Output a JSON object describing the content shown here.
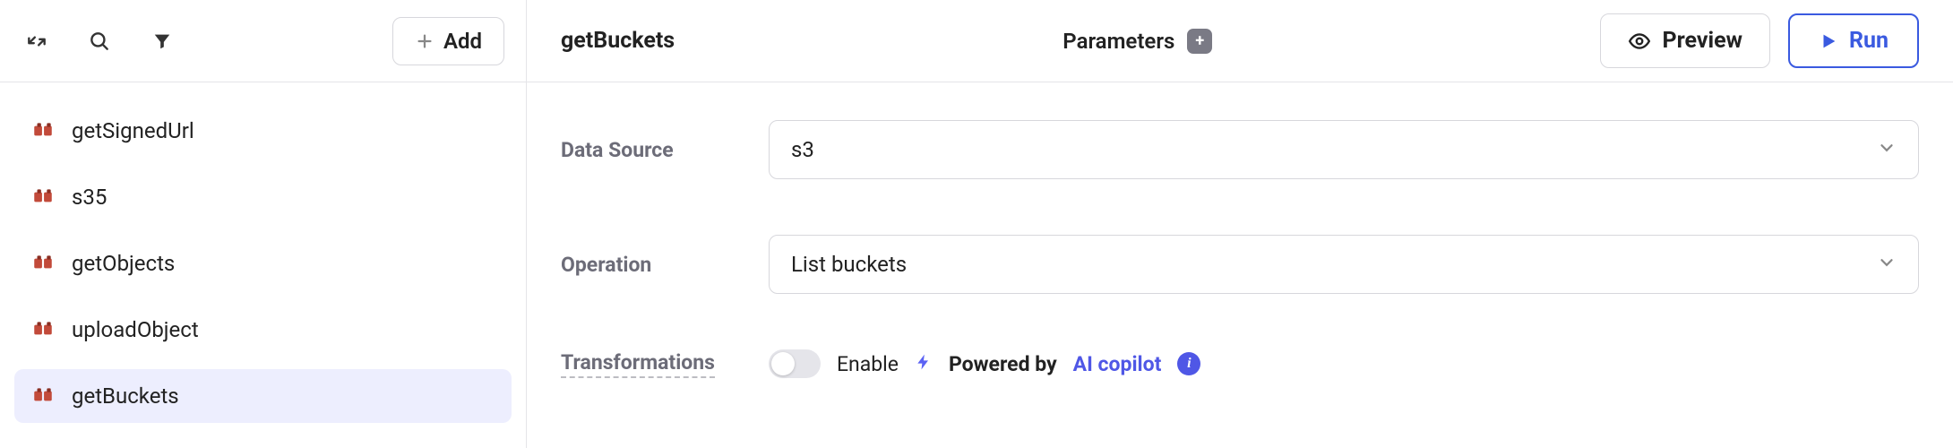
{
  "sidebar": {
    "add_label": "Add",
    "items": [
      {
        "label": "getSignedUrl",
        "selected": false
      },
      {
        "label": "s35",
        "selected": false
      },
      {
        "label": "getObjects",
        "selected": false
      },
      {
        "label": "uploadObject",
        "selected": false
      },
      {
        "label": "getBuckets",
        "selected": true
      }
    ]
  },
  "header": {
    "title": "getBuckets",
    "parameters_label": "Parameters",
    "preview_label": "Preview",
    "run_label": "Run"
  },
  "form": {
    "data_source": {
      "label": "Data Source",
      "value": "s3"
    },
    "operation": {
      "label": "Operation",
      "value": "List buckets"
    },
    "transformations": {
      "label": "Transformations",
      "enable_label": "Enable",
      "enabled": false,
      "powered_prefix": "Powered by",
      "copilot_label": "AI copilot"
    }
  }
}
